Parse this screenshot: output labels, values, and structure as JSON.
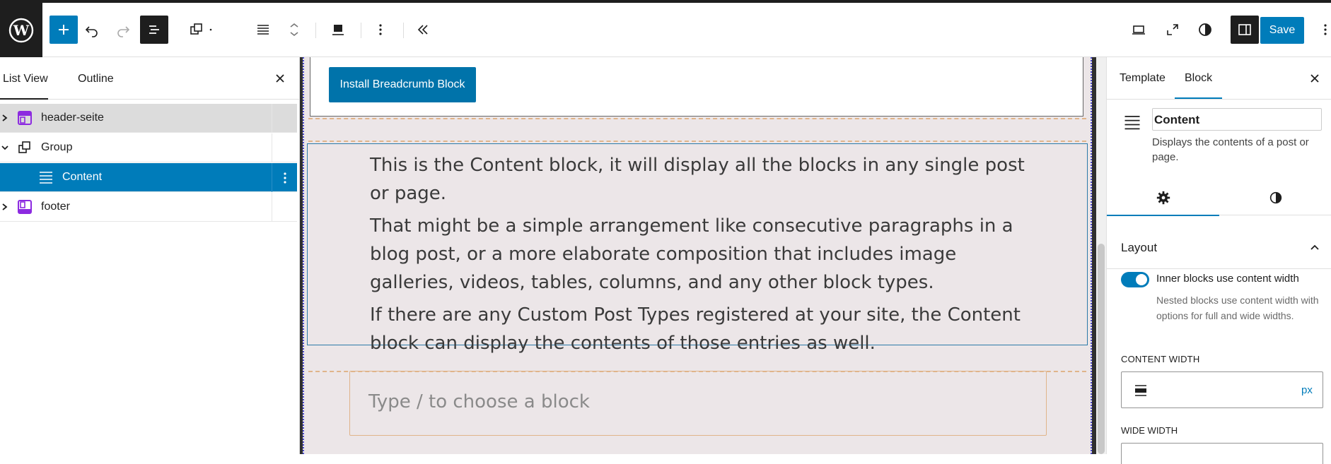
{
  "toolbar": {
    "save_label": "Save"
  },
  "list_panel": {
    "tabs": [
      "List View",
      "Outline"
    ],
    "items": [
      {
        "label": "header-seite",
        "icon": "template-part-icon"
      },
      {
        "label": "Group",
        "icon": "group-icon"
      },
      {
        "label": "Content",
        "icon": "post-content-icon"
      },
      {
        "label": "footer",
        "icon": "template-part-icon"
      }
    ]
  },
  "canvas": {
    "install_button": "Install Breadcrumb Block",
    "paragraphs": [
      "This is the Content block, it will display all the blocks in any single post or page.",
      "That might be a simple arrangement like consecutive paragraphs in a blog post, or a more elaborate composition that includes image galleries, videos, tables, columns, and any other block types.",
      "If there are any Custom Post Types registered at your site, the Content block can display the contents of those entries as well."
    ],
    "appender_placeholder": "Type / to choose a block"
  },
  "inspector": {
    "tabs": [
      "Template",
      "Block"
    ],
    "block_name": "Content",
    "block_description": "Displays the contents of a post or page.",
    "layout_title": "Layout",
    "toggle_label": "Inner blocks use content width",
    "toggle_help": "Nested blocks use content width with options for full and wide widths.",
    "content_width_label": "CONTENT WIDTH",
    "content_width_unit": "px",
    "wide_width_label": "WIDE WIDTH"
  },
  "colors": {
    "accent": "#007cba",
    "dark": "#1e1e1e",
    "template_part": "#8c2ae0"
  }
}
